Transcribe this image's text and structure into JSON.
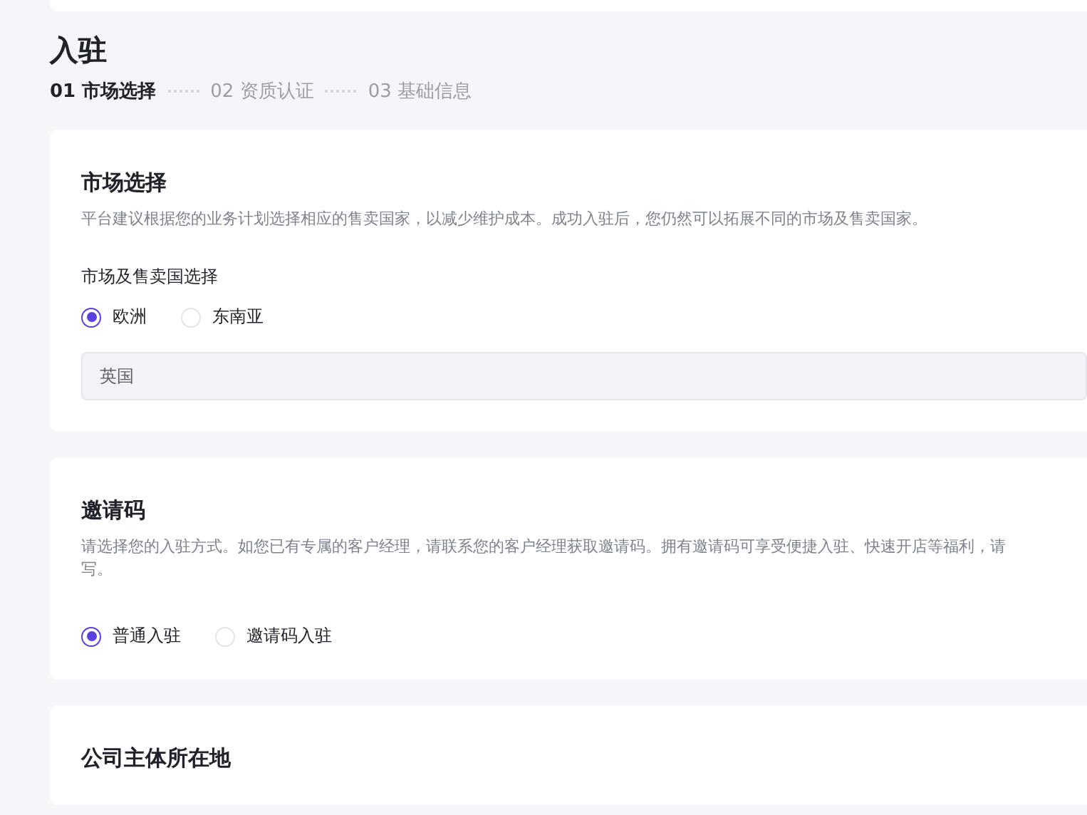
{
  "header": {
    "title": "入驻",
    "steps": [
      {
        "label": "01 市场选择",
        "active": true
      },
      {
        "label": "02 资质认证",
        "active": false
      },
      {
        "label": "03 基础信息",
        "active": false
      }
    ]
  },
  "sections": [
    {
      "title": "市场选择",
      "description_lines": [
        "平台建议根据您的业务计划选择相应的售卖国家，以减少维护成本。成功入驻后，您仍然可以拓展不同的市场及售卖国家。"
      ],
      "fields": [
        {
          "kind": "radio-group",
          "label": "市场及售卖国选择",
          "options": [
            {
              "label": "欧洲",
              "selected": true
            },
            {
              "label": "东南亚",
              "selected": false
            }
          ]
        },
        {
          "kind": "select",
          "value": "英国"
        }
      ]
    },
    {
      "title": "邀请码",
      "description_lines": [
        "请选择您的入驻方式。如您已有专属的客户经理，请联系您的客户经理获取邀请码。拥有邀请码可享受便捷入驻、快速开店等福利，请",
        "写。"
      ],
      "fields": [
        {
          "kind": "radio-group",
          "options": [
            {
              "label": "普通入驻",
              "selected": true
            },
            {
              "label": "邀请码入驻",
              "selected": false
            }
          ]
        }
      ]
    },
    {
      "title": "公司主体所在地"
    }
  ]
}
